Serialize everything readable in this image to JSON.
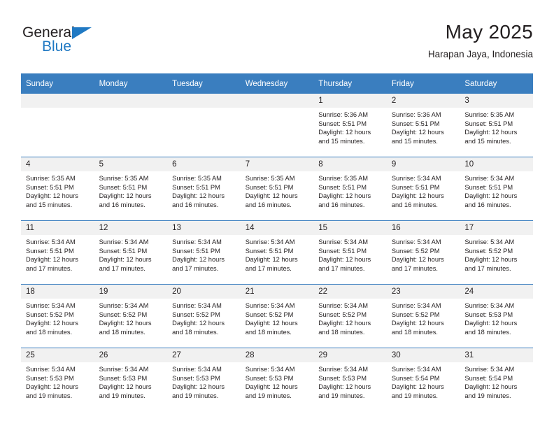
{
  "brand": {
    "name_line1": "General",
    "name_line2": "Blue",
    "accent_color": "#2079c3"
  },
  "header": {
    "title": "May 2025",
    "subtitle": "Harapan Jaya, Indonesia"
  },
  "theme": {
    "header_row_bg": "#3a7ebf",
    "daynum_bg": "#f1f1f1",
    "text_color": "#231f20"
  },
  "weekday_headers": [
    "Sunday",
    "Monday",
    "Tuesday",
    "Wednesday",
    "Thursday",
    "Friday",
    "Saturday"
  ],
  "weeks": [
    [
      {
        "day": "",
        "empty": true
      },
      {
        "day": "",
        "empty": true
      },
      {
        "day": "",
        "empty": true
      },
      {
        "day": "",
        "empty": true
      },
      {
        "day": "1",
        "sunrise": "Sunrise: 5:36 AM",
        "sunset": "Sunset: 5:51 PM",
        "daylight_1": "Daylight: 12 hours",
        "daylight_2": "and 15 minutes."
      },
      {
        "day": "2",
        "sunrise": "Sunrise: 5:36 AM",
        "sunset": "Sunset: 5:51 PM",
        "daylight_1": "Daylight: 12 hours",
        "daylight_2": "and 15 minutes."
      },
      {
        "day": "3",
        "sunrise": "Sunrise: 5:35 AM",
        "sunset": "Sunset: 5:51 PM",
        "daylight_1": "Daylight: 12 hours",
        "daylight_2": "and 15 minutes."
      }
    ],
    [
      {
        "day": "4",
        "sunrise": "Sunrise: 5:35 AM",
        "sunset": "Sunset: 5:51 PM",
        "daylight_1": "Daylight: 12 hours",
        "daylight_2": "and 15 minutes."
      },
      {
        "day": "5",
        "sunrise": "Sunrise: 5:35 AM",
        "sunset": "Sunset: 5:51 PM",
        "daylight_1": "Daylight: 12 hours",
        "daylight_2": "and 16 minutes."
      },
      {
        "day": "6",
        "sunrise": "Sunrise: 5:35 AM",
        "sunset": "Sunset: 5:51 PM",
        "daylight_1": "Daylight: 12 hours",
        "daylight_2": "and 16 minutes."
      },
      {
        "day": "7",
        "sunrise": "Sunrise: 5:35 AM",
        "sunset": "Sunset: 5:51 PM",
        "daylight_1": "Daylight: 12 hours",
        "daylight_2": "and 16 minutes."
      },
      {
        "day": "8",
        "sunrise": "Sunrise: 5:35 AM",
        "sunset": "Sunset: 5:51 PM",
        "daylight_1": "Daylight: 12 hours",
        "daylight_2": "and 16 minutes."
      },
      {
        "day": "9",
        "sunrise": "Sunrise: 5:34 AM",
        "sunset": "Sunset: 5:51 PM",
        "daylight_1": "Daylight: 12 hours",
        "daylight_2": "and 16 minutes."
      },
      {
        "day": "10",
        "sunrise": "Sunrise: 5:34 AM",
        "sunset": "Sunset: 5:51 PM",
        "daylight_1": "Daylight: 12 hours",
        "daylight_2": "and 16 minutes."
      }
    ],
    [
      {
        "day": "11",
        "sunrise": "Sunrise: 5:34 AM",
        "sunset": "Sunset: 5:51 PM",
        "daylight_1": "Daylight: 12 hours",
        "daylight_2": "and 17 minutes."
      },
      {
        "day": "12",
        "sunrise": "Sunrise: 5:34 AM",
        "sunset": "Sunset: 5:51 PM",
        "daylight_1": "Daylight: 12 hours",
        "daylight_2": "and 17 minutes."
      },
      {
        "day": "13",
        "sunrise": "Sunrise: 5:34 AM",
        "sunset": "Sunset: 5:51 PM",
        "daylight_1": "Daylight: 12 hours",
        "daylight_2": "and 17 minutes."
      },
      {
        "day": "14",
        "sunrise": "Sunrise: 5:34 AM",
        "sunset": "Sunset: 5:51 PM",
        "daylight_1": "Daylight: 12 hours",
        "daylight_2": "and 17 minutes."
      },
      {
        "day": "15",
        "sunrise": "Sunrise: 5:34 AM",
        "sunset": "Sunset: 5:51 PM",
        "daylight_1": "Daylight: 12 hours",
        "daylight_2": "and 17 minutes."
      },
      {
        "day": "16",
        "sunrise": "Sunrise: 5:34 AM",
        "sunset": "Sunset: 5:52 PM",
        "daylight_1": "Daylight: 12 hours",
        "daylight_2": "and 17 minutes."
      },
      {
        "day": "17",
        "sunrise": "Sunrise: 5:34 AM",
        "sunset": "Sunset: 5:52 PM",
        "daylight_1": "Daylight: 12 hours",
        "daylight_2": "and 17 minutes."
      }
    ],
    [
      {
        "day": "18",
        "sunrise": "Sunrise: 5:34 AM",
        "sunset": "Sunset: 5:52 PM",
        "daylight_1": "Daylight: 12 hours",
        "daylight_2": "and 18 minutes."
      },
      {
        "day": "19",
        "sunrise": "Sunrise: 5:34 AM",
        "sunset": "Sunset: 5:52 PM",
        "daylight_1": "Daylight: 12 hours",
        "daylight_2": "and 18 minutes."
      },
      {
        "day": "20",
        "sunrise": "Sunrise: 5:34 AM",
        "sunset": "Sunset: 5:52 PM",
        "daylight_1": "Daylight: 12 hours",
        "daylight_2": "and 18 minutes."
      },
      {
        "day": "21",
        "sunrise": "Sunrise: 5:34 AM",
        "sunset": "Sunset: 5:52 PM",
        "daylight_1": "Daylight: 12 hours",
        "daylight_2": "and 18 minutes."
      },
      {
        "day": "22",
        "sunrise": "Sunrise: 5:34 AM",
        "sunset": "Sunset: 5:52 PM",
        "daylight_1": "Daylight: 12 hours",
        "daylight_2": "and 18 minutes."
      },
      {
        "day": "23",
        "sunrise": "Sunrise: 5:34 AM",
        "sunset": "Sunset: 5:52 PM",
        "daylight_1": "Daylight: 12 hours",
        "daylight_2": "and 18 minutes."
      },
      {
        "day": "24",
        "sunrise": "Sunrise: 5:34 AM",
        "sunset": "Sunset: 5:53 PM",
        "daylight_1": "Daylight: 12 hours",
        "daylight_2": "and 18 minutes."
      }
    ],
    [
      {
        "day": "25",
        "sunrise": "Sunrise: 5:34 AM",
        "sunset": "Sunset: 5:53 PM",
        "daylight_1": "Daylight: 12 hours",
        "daylight_2": "and 19 minutes."
      },
      {
        "day": "26",
        "sunrise": "Sunrise: 5:34 AM",
        "sunset": "Sunset: 5:53 PM",
        "daylight_1": "Daylight: 12 hours",
        "daylight_2": "and 19 minutes."
      },
      {
        "day": "27",
        "sunrise": "Sunrise: 5:34 AM",
        "sunset": "Sunset: 5:53 PM",
        "daylight_1": "Daylight: 12 hours",
        "daylight_2": "and 19 minutes."
      },
      {
        "day": "28",
        "sunrise": "Sunrise: 5:34 AM",
        "sunset": "Sunset: 5:53 PM",
        "daylight_1": "Daylight: 12 hours",
        "daylight_2": "and 19 minutes."
      },
      {
        "day": "29",
        "sunrise": "Sunrise: 5:34 AM",
        "sunset": "Sunset: 5:53 PM",
        "daylight_1": "Daylight: 12 hours",
        "daylight_2": "and 19 minutes."
      },
      {
        "day": "30",
        "sunrise": "Sunrise: 5:34 AM",
        "sunset": "Sunset: 5:54 PM",
        "daylight_1": "Daylight: 12 hours",
        "daylight_2": "and 19 minutes."
      },
      {
        "day": "31",
        "sunrise": "Sunrise: 5:34 AM",
        "sunset": "Sunset: 5:54 PM",
        "daylight_1": "Daylight: 12 hours",
        "daylight_2": "and 19 minutes."
      }
    ]
  ]
}
